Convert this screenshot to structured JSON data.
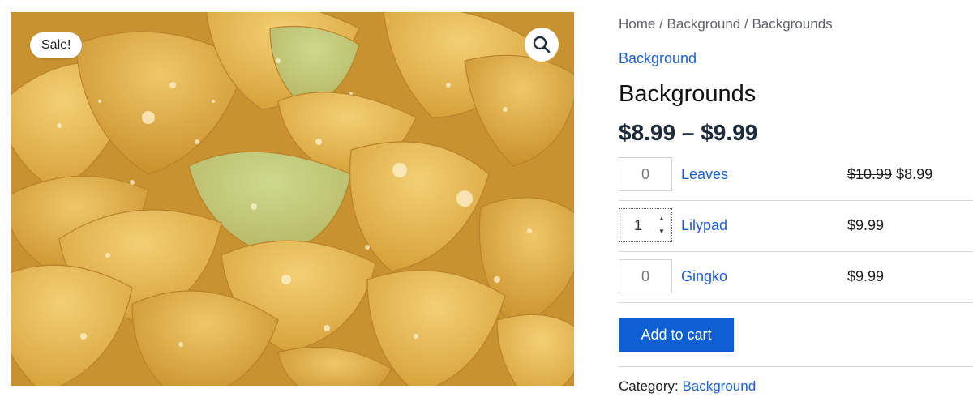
{
  "gallery": {
    "sale_badge": "Sale!",
    "zoom_icon": "magnifier-icon",
    "image_subject": "yellow ginkgo leaves with water droplets"
  },
  "breadcrumb": {
    "items": [
      "Home",
      "Background",
      "Backgrounds"
    ],
    "separator": " / "
  },
  "product": {
    "category": "Background",
    "title": "Backgrounds",
    "price_range": "$8.99 – $9.99"
  },
  "grouped_items": [
    {
      "quantity": "0",
      "name": "Leaves",
      "old_price": "$10.99",
      "price": "$8.99"
    },
    {
      "quantity": "1",
      "name": "Lilypad",
      "old_price": "",
      "price": "$9.99"
    },
    {
      "quantity": "0",
      "name": "Gingko",
      "old_price": "",
      "price": "$9.99"
    }
  ],
  "actions": {
    "add_to_cart": "Add to cart"
  },
  "meta": {
    "category_label": "Category:",
    "category_value": "Background"
  },
  "colors": {
    "link": "#1f5fcf",
    "button": "#0d5fd3",
    "price": "#1c2a3a"
  }
}
